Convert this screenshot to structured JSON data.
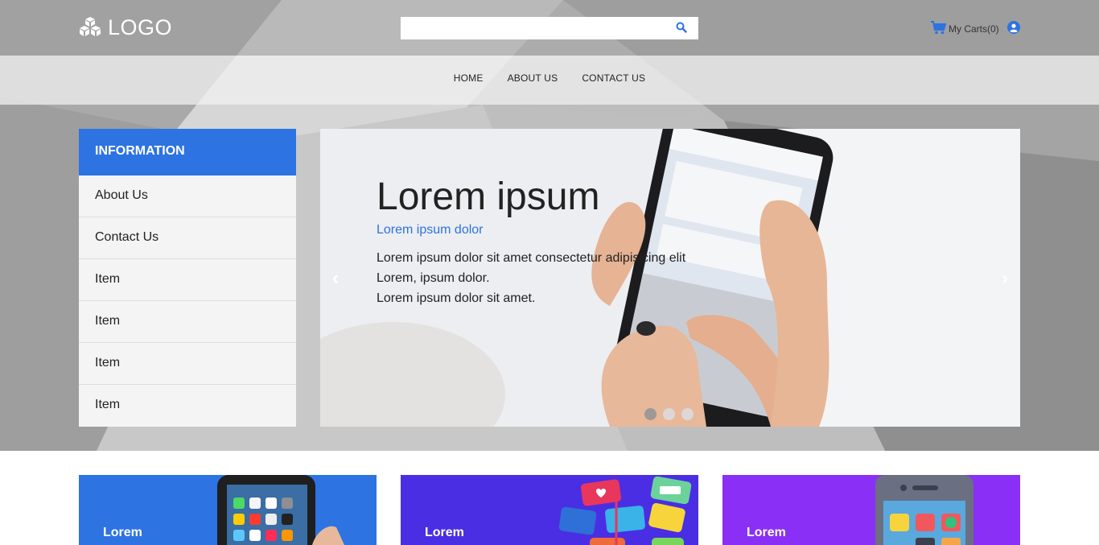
{
  "header": {
    "logo_text": "LOGO",
    "search_placeholder": "",
    "cart_label": "My Carts(0)",
    "accent_color": "#2d73e2"
  },
  "nav": {
    "items": [
      "HOME",
      "ABOUT US",
      "CONTACT US"
    ]
  },
  "sidebar": {
    "title": "INFORMATION",
    "items": [
      "About Us",
      "Contact Us",
      "Item",
      "Item",
      "Item",
      "Item"
    ]
  },
  "carousel": {
    "title": "Lorem ipsum",
    "subtitle": "Lorem ipsum dolor",
    "lines": [
      "Lorem ipsum dolor sit amet consectetur adipisicing elit",
      "Lorem, ipsum dolor.",
      "Lorem ipsum dolor sit amet."
    ],
    "prev_symbol": "‹",
    "next_symbol": "›",
    "active_slide": 1,
    "slide_count": 3
  },
  "cards": [
    {
      "label": "Lorem",
      "color": "#2d73e2"
    },
    {
      "label": "Lorem",
      "color": "#4a2ee3"
    },
    {
      "label": "Lorem",
      "color": "#8a2ff5"
    }
  ]
}
